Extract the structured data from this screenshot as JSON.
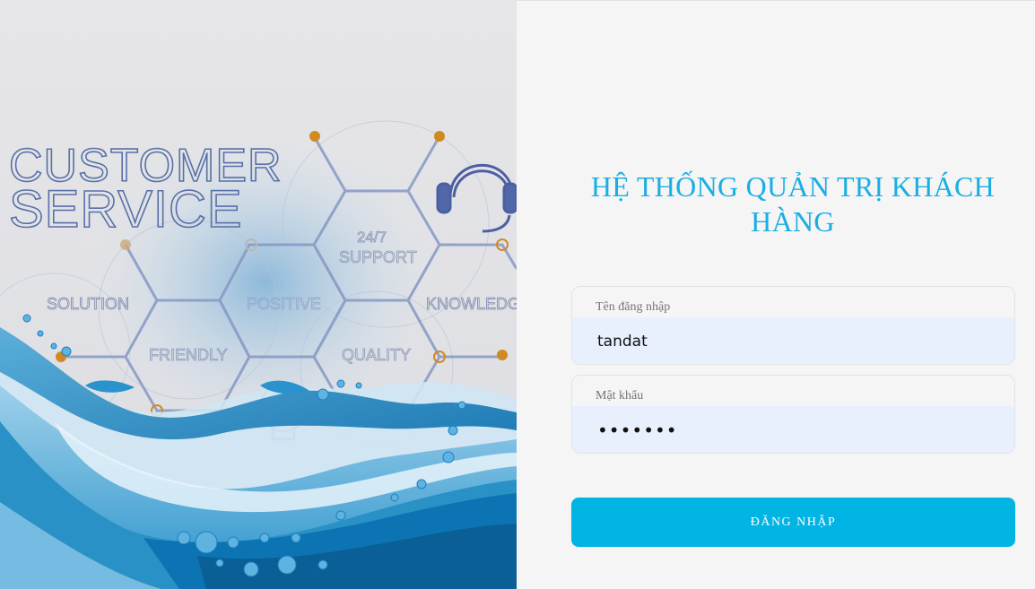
{
  "hero": {
    "heading_line1": "CUSTOMER",
    "heading_line2": "SERVICE",
    "hex_labels": {
      "support_top": "24/7",
      "support_bottom": "SUPPORT",
      "solution": "SOLUTION",
      "positive": "POSITIVE",
      "knowledge": "KNOWLEDGE",
      "friendly": "FRIENDLY",
      "quality": "QUALITY"
    },
    "colors": {
      "accent_dot": "#d08a22",
      "line": "#7f92be",
      "water": "#1a8dc4"
    }
  },
  "login": {
    "title": "HỆ THỐNG QUẢN TRỊ KHÁCH HÀNG",
    "username_label": "Tên đăng nhập",
    "username_value": "tandat",
    "password_label": "Mật khẩu",
    "password_value": "•••••••",
    "submit_label": "ĐĂNG NHẬP"
  },
  "colors": {
    "accent": "#1aaee3",
    "button": "#00b4e4",
    "autofill_bg": "#e8f0fe"
  }
}
